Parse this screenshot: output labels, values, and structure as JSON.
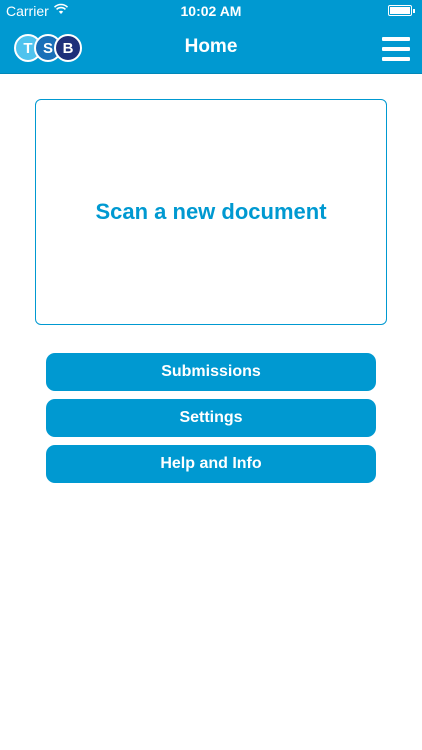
{
  "status_bar": {
    "carrier": "Carrier",
    "time": "10:02 AM"
  },
  "navbar": {
    "logo_letters": [
      "T",
      "S",
      "B"
    ],
    "title": "Home"
  },
  "scan_card": {
    "label": "Scan a new document"
  },
  "buttons": {
    "submissions": "Submissions",
    "settings": "Settings",
    "help": "Help and Info"
  },
  "colors": {
    "brand_blue": "#0099d1",
    "logo_light": "#4fc3ee",
    "logo_mid": "#1a6fb8",
    "logo_dark": "#1e2f7a"
  },
  "icons": {
    "wifi": "wifi-icon",
    "battery": "battery-icon",
    "menu": "hamburger-menu-icon"
  }
}
